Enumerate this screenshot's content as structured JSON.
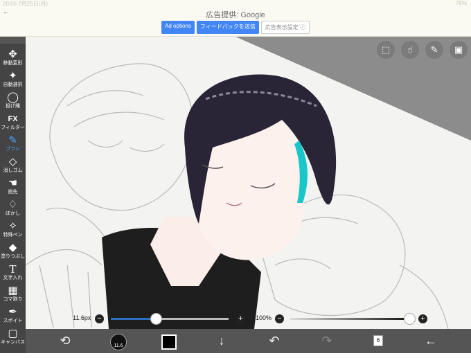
{
  "status": {
    "time": "20:06",
    "date": "7月25日(月)",
    "battery": "75%"
  },
  "ad": {
    "title_prefix": "広告提供: ",
    "title_brand": "Google",
    "options_label": "Ad options",
    "feedback_label": "フィードバックを送信",
    "settings_label": "広告表示設定 ⓘ"
  },
  "tools": [
    {
      "icon": "✥",
      "label": "移動変形"
    },
    {
      "icon": "✦",
      "label": "自動選択"
    },
    {
      "icon": "◯",
      "label": "投げ縄"
    },
    {
      "icon": "FX",
      "label": "フィルター"
    },
    {
      "icon": "✎",
      "label": "ブラシ"
    },
    {
      "icon": "◇",
      "label": "消しゴム"
    },
    {
      "icon": "☚",
      "label": "指先"
    },
    {
      "icon": "♢",
      "label": "ぼかし"
    },
    {
      "icon": "✧",
      "label": "特殊ペン"
    },
    {
      "icon": "◆",
      "label": "塗りつぶし"
    },
    {
      "icon": "T",
      "label": "文字入れ"
    },
    {
      "icon": "▦",
      "label": "コマ割り"
    },
    {
      "icon": "✒",
      "label": "スポイト"
    },
    {
      "icon": "▢",
      "label": "キャンバス"
    }
  ],
  "brush": {
    "size_label": "11.6px",
    "size_fraction": 0.38,
    "opacity_label": "100%",
    "opacity_fraction": 1.0,
    "preview": "11.6"
  },
  "layers": {
    "count": "6"
  },
  "colors": {
    "accent": "#4aa3ff",
    "toolbar": "#444444",
    "slider": "#2f6fc4"
  }
}
